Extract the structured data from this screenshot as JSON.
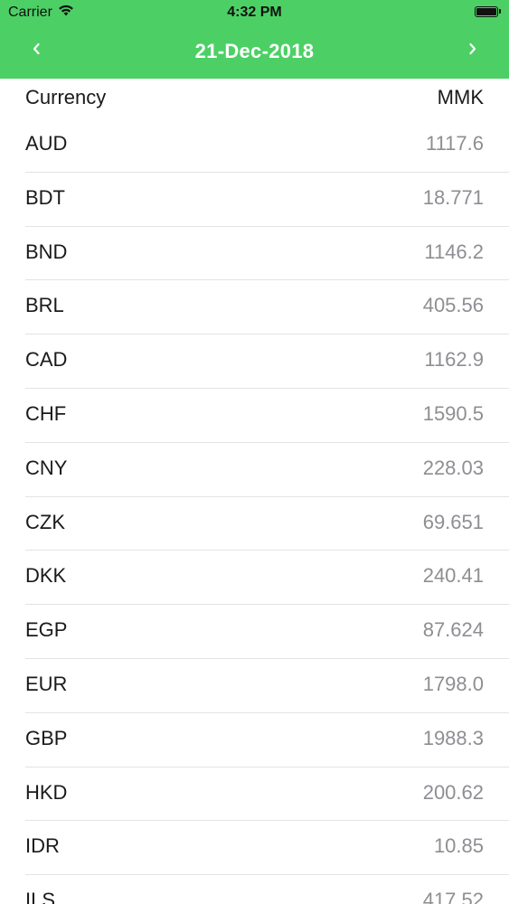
{
  "status_bar": {
    "carrier": "Carrier",
    "time": "4:32 PM",
    "icons": [
      "wifi-icon",
      "battery-icon"
    ]
  },
  "nav": {
    "title": "21-Dec-2018",
    "prev_icon": "chevron-left-icon",
    "next_icon": "chevron-right-icon",
    "color": "#4cd065"
  },
  "table": {
    "header_left": "Currency",
    "header_right": "MMK",
    "rows": [
      {
        "code": "AUD",
        "rate": "1117.6"
      },
      {
        "code": "BDT",
        "rate": "18.771"
      },
      {
        "code": "BND",
        "rate": "1146.2"
      },
      {
        "code": "BRL",
        "rate": "405.56"
      },
      {
        "code": "CAD",
        "rate": "1162.9"
      },
      {
        "code": "CHF",
        "rate": "1590.5"
      },
      {
        "code": "CNY",
        "rate": "228.03"
      },
      {
        "code": "CZK",
        "rate": "69.651"
      },
      {
        "code": "DKK",
        "rate": "240.41"
      },
      {
        "code": "EGP",
        "rate": "87.624"
      },
      {
        "code": "EUR",
        "rate": "1798.0"
      },
      {
        "code": "GBP",
        "rate": "1988.3"
      },
      {
        "code": "HKD",
        "rate": "200.62"
      },
      {
        "code": "IDR",
        "rate": "10.85"
      },
      {
        "code": "ILS",
        "rate": "417.52"
      }
    ]
  }
}
